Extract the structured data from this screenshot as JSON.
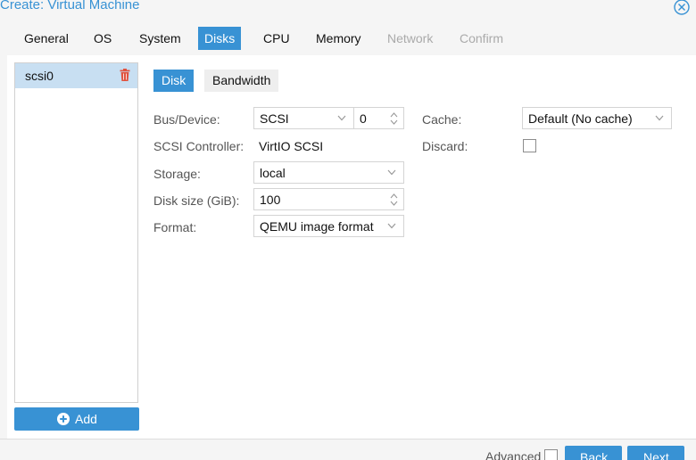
{
  "window": {
    "title": "Create: Virtual Machine"
  },
  "tabs": [
    {
      "label": "General",
      "state": "normal"
    },
    {
      "label": "OS",
      "state": "normal"
    },
    {
      "label": "System",
      "state": "normal"
    },
    {
      "label": "Disks",
      "state": "active"
    },
    {
      "label": "CPU",
      "state": "normal"
    },
    {
      "label": "Memory",
      "state": "normal"
    },
    {
      "label": "Network",
      "state": "disabled"
    },
    {
      "label": "Confirm",
      "state": "disabled"
    }
  ],
  "disks": {
    "items": [
      {
        "label": "scsi0",
        "selected": true
      }
    ],
    "add_label": "Add"
  },
  "subtabs": {
    "disk": "Disk",
    "bandwidth": "Bandwidth"
  },
  "form": {
    "bus_device": {
      "label": "Bus/Device:",
      "bus": "SCSI",
      "device": "0"
    },
    "scsi_controller": {
      "label": "SCSI Controller:",
      "value": "VirtIO SCSI"
    },
    "storage": {
      "label": "Storage:",
      "value": "local"
    },
    "disk_size": {
      "label": "Disk size (GiB):",
      "value": "100"
    },
    "format": {
      "label": "Format:",
      "value": "QEMU image format"
    },
    "cache": {
      "label": "Cache:",
      "value": "Default (No cache)"
    },
    "discard": {
      "label": "Discard:",
      "checked": false
    }
  },
  "footer": {
    "advanced_label": "Advanced",
    "advanced_checked": false,
    "back_label": "Back",
    "next_label": "Next"
  },
  "colors": {
    "accent": "#3892d4",
    "selected_row": "#c8dff2",
    "delete": "#e0533f"
  },
  "icons": {
    "close": "close-circle-icon",
    "delete": "trash-icon",
    "add": "plus-circle-icon",
    "dropdown": "chevron-down-icon",
    "spinner": "spinner-arrows-icon"
  }
}
